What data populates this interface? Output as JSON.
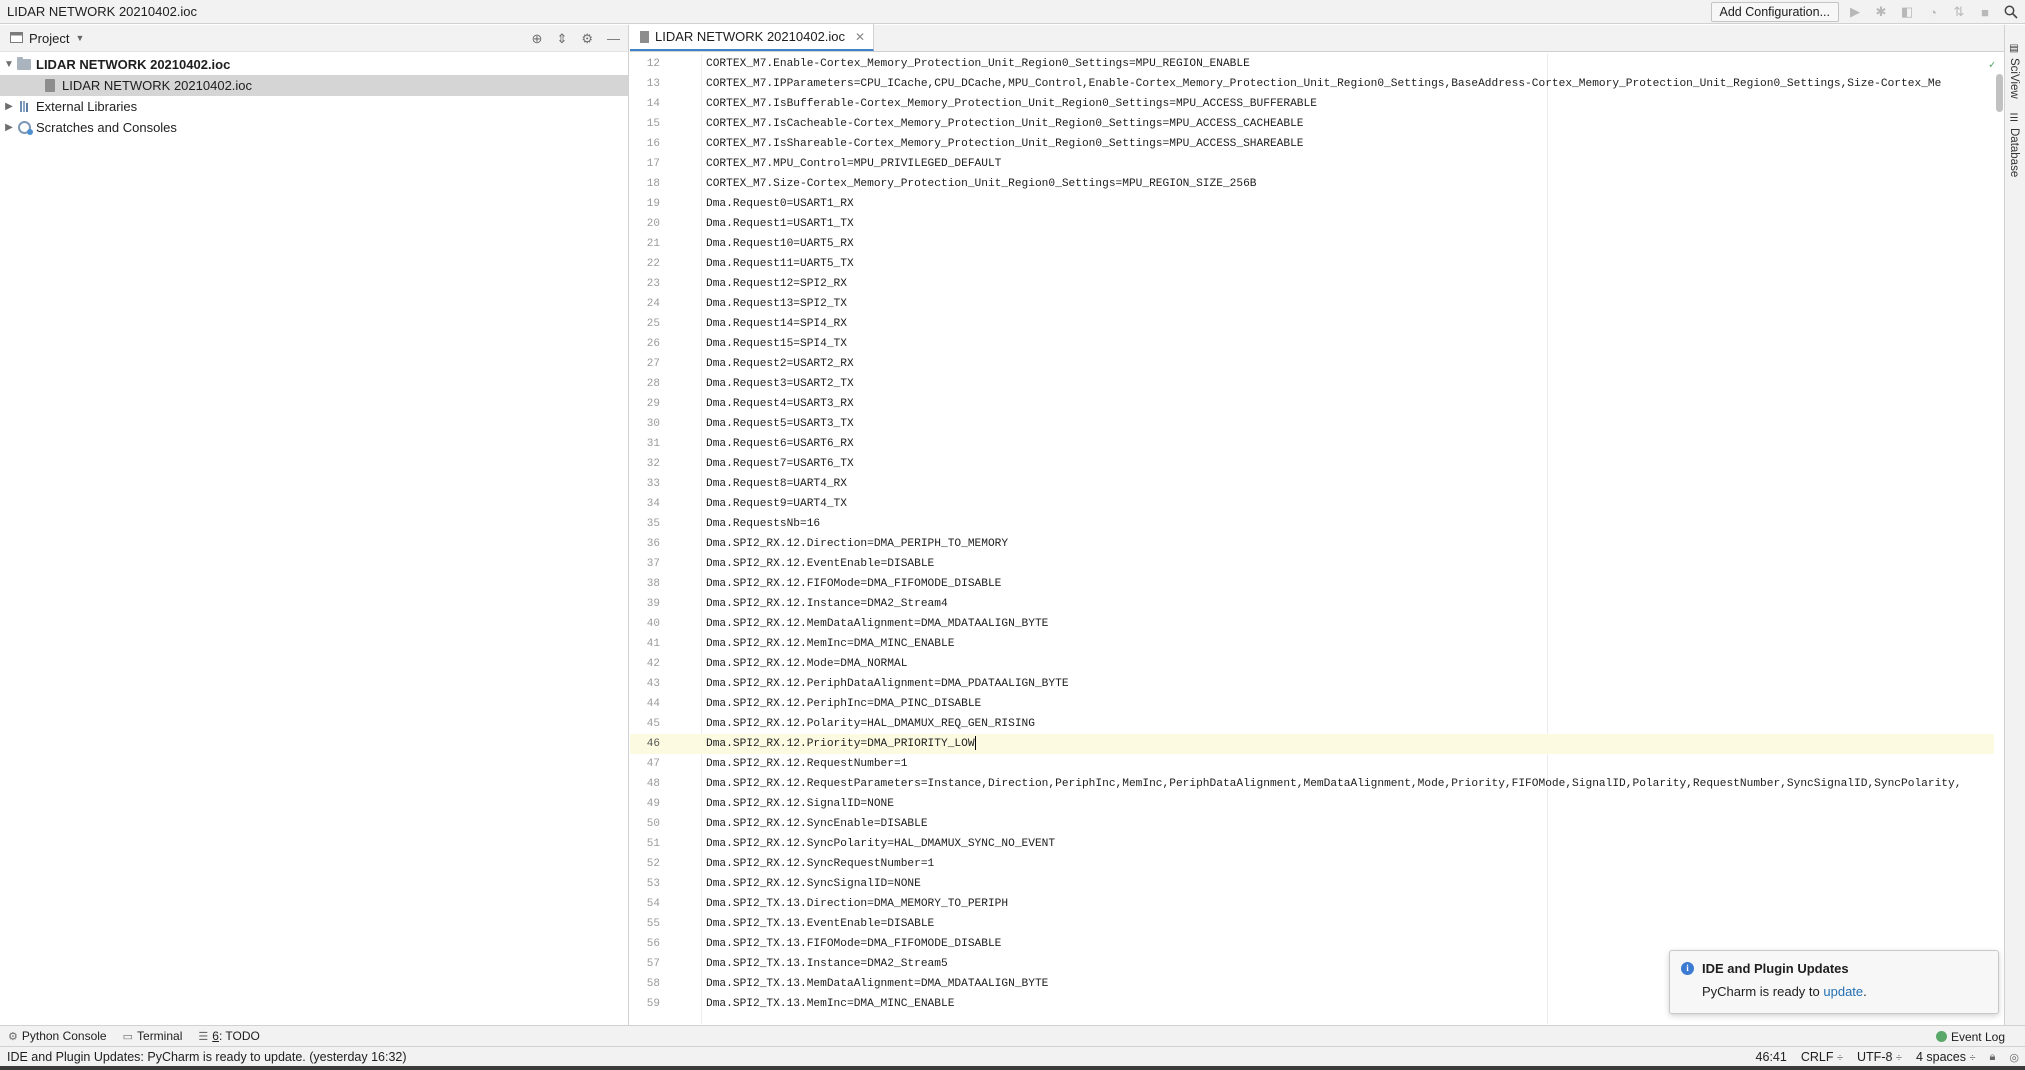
{
  "window": {
    "title": "LIDAR NETWORK 20210402.ioc"
  },
  "toolbar": {
    "add_configuration": "Add Configuration...",
    "icons": [
      "run-icon",
      "debug-icon",
      "coverage-icon",
      "profile-icon",
      "build-icon",
      "stop-icon",
      "search-icon"
    ]
  },
  "project_panel": {
    "title": "Project",
    "tree": [
      {
        "label": "LIDAR NETWORK 20210402.ioc",
        "level": 0,
        "type": "folder",
        "expanded": true,
        "bold": true
      },
      {
        "label": "LIDAR NETWORK 20210402.ioc",
        "level": 1,
        "type": "file",
        "selected": true
      },
      {
        "label": "External Libraries",
        "level": 0,
        "type": "libraries",
        "expanded": false
      },
      {
        "label": "Scratches and Consoles",
        "level": 0,
        "type": "scratches",
        "expanded": false
      }
    ]
  },
  "editor": {
    "tab_label": "LIDAR NETWORK 20210402.ioc",
    "current_line": 46,
    "lines": [
      {
        "n": 12,
        "t": "CORTEX_M7.Enable-Cortex_Memory_Protection_Unit_Region0_Settings=MPU_REGION_ENABLE"
      },
      {
        "n": 13,
        "t": "CORTEX_M7.IPParameters=CPU_ICache,CPU_DCache,MPU_Control,Enable-Cortex_Memory_Protection_Unit_Region0_Settings,BaseAddress-Cortex_Memory_Protection_Unit_Region0_Settings,Size-Cortex_Me"
      },
      {
        "n": 14,
        "t": "CORTEX_M7.IsBufferable-Cortex_Memory_Protection_Unit_Region0_Settings=MPU_ACCESS_BUFFERABLE"
      },
      {
        "n": 15,
        "t": "CORTEX_M7.IsCacheable-Cortex_Memory_Protection_Unit_Region0_Settings=MPU_ACCESS_CACHEABLE"
      },
      {
        "n": 16,
        "t": "CORTEX_M7.IsShareable-Cortex_Memory_Protection_Unit_Region0_Settings=MPU_ACCESS_SHAREABLE"
      },
      {
        "n": 17,
        "t": "CORTEX_M7.MPU_Control=MPU_PRIVILEGED_DEFAULT"
      },
      {
        "n": 18,
        "t": "CORTEX_M7.Size-Cortex_Memory_Protection_Unit_Region0_Settings=MPU_REGION_SIZE_256B"
      },
      {
        "n": 19,
        "t": "Dma.Request0=USART1_RX"
      },
      {
        "n": 20,
        "t": "Dma.Request1=USART1_TX"
      },
      {
        "n": 21,
        "t": "Dma.Request10=UART5_RX"
      },
      {
        "n": 22,
        "t": "Dma.Request11=UART5_TX"
      },
      {
        "n": 23,
        "t": "Dma.Request12=SPI2_RX"
      },
      {
        "n": 24,
        "t": "Dma.Request13=SPI2_TX"
      },
      {
        "n": 25,
        "t": "Dma.Request14=SPI4_RX"
      },
      {
        "n": 26,
        "t": "Dma.Request15=SPI4_TX"
      },
      {
        "n": 27,
        "t": "Dma.Request2=USART2_RX"
      },
      {
        "n": 28,
        "t": "Dma.Request3=USART2_TX"
      },
      {
        "n": 29,
        "t": "Dma.Request4=USART3_RX"
      },
      {
        "n": 30,
        "t": "Dma.Request5=USART3_TX"
      },
      {
        "n": 31,
        "t": "Dma.Request6=USART6_RX"
      },
      {
        "n": 32,
        "t": "Dma.Request7=USART6_TX"
      },
      {
        "n": 33,
        "t": "Dma.Request8=UART4_RX"
      },
      {
        "n": 34,
        "t": "Dma.Request9=UART4_TX"
      },
      {
        "n": 35,
        "t": "Dma.RequestsNb=16"
      },
      {
        "n": 36,
        "t": "Dma.SPI2_RX.12.Direction=DMA_PERIPH_TO_MEMORY"
      },
      {
        "n": 37,
        "t": "Dma.SPI2_RX.12.EventEnable=DISABLE"
      },
      {
        "n": 38,
        "t": "Dma.SPI2_RX.12.FIFOMode=DMA_FIFOMODE_DISABLE"
      },
      {
        "n": 39,
        "t": "Dma.SPI2_RX.12.Instance=DMA2_Stream4"
      },
      {
        "n": 40,
        "t": "Dma.SPI2_RX.12.MemDataAlignment=DMA_MDATAALIGN_BYTE"
      },
      {
        "n": 41,
        "t": "Dma.SPI2_RX.12.MemInc=DMA_MINC_ENABLE"
      },
      {
        "n": 42,
        "t": "Dma.SPI2_RX.12.Mode=DMA_NORMAL"
      },
      {
        "n": 43,
        "t": "Dma.SPI2_RX.12.PeriphDataAlignment=DMA_PDATAALIGN_BYTE"
      },
      {
        "n": 44,
        "t": "Dma.SPI2_RX.12.PeriphInc=DMA_PINC_DISABLE"
      },
      {
        "n": 45,
        "t": "Dma.SPI2_RX.12.Polarity=HAL_DMAMUX_REQ_GEN_RISING"
      },
      {
        "n": 46,
        "t": "Dma.SPI2_RX.12.Priority=DMA_PRIORITY_LOW"
      },
      {
        "n": 47,
        "t": "Dma.SPI2_RX.12.RequestNumber=1"
      },
      {
        "n": 48,
        "t": "Dma.SPI2_RX.12.RequestParameters=Instance,Direction,PeriphInc,MemInc,PeriphDataAlignment,MemDataAlignment,Mode,Priority,FIFOMode,SignalID,Polarity,RequestNumber,SyncSignalID,SyncPolarity,"
      },
      {
        "n": 49,
        "t": "Dma.SPI2_RX.12.SignalID=NONE"
      },
      {
        "n": 50,
        "t": "Dma.SPI2_RX.12.SyncEnable=DISABLE"
      },
      {
        "n": 51,
        "t": "Dma.SPI2_RX.12.SyncPolarity=HAL_DMAMUX_SYNC_NO_EVENT"
      },
      {
        "n": 52,
        "t": "Dma.SPI2_RX.12.SyncRequestNumber=1"
      },
      {
        "n": 53,
        "t": "Dma.SPI2_RX.12.SyncSignalID=NONE"
      },
      {
        "n": 54,
        "t": "Dma.SPI2_TX.13.Direction=DMA_MEMORY_TO_PERIPH"
      },
      {
        "n": 55,
        "t": "Dma.SPI2_TX.13.EventEnable=DISABLE"
      },
      {
        "n": 56,
        "t": "Dma.SPI2_TX.13.FIFOMode=DMA_FIFOMODE_DISABLE"
      },
      {
        "n": 57,
        "t": "Dma.SPI2_TX.13.Instance=DMA2_Stream5"
      },
      {
        "n": 58,
        "t": "Dma.SPI2_TX.13.MemDataAlignment=DMA_MDATAALIGN_BYTE"
      },
      {
        "n": 59,
        "t": "Dma.SPI2_TX.13.MemInc=DMA_MINC_ENABLE"
      }
    ]
  },
  "right_stripe": {
    "sciview": "SciView",
    "database": "Database"
  },
  "notification": {
    "title": "IDE and Plugin Updates",
    "body_prefix": "PyCharm is ready to ",
    "link": "update",
    "body_suffix": "."
  },
  "tool_windows": {
    "python_console": "Python Console",
    "terminal": "Terminal",
    "todo_number": "6",
    "todo_label": ": TODO",
    "event_log": "Event Log"
  },
  "status": {
    "message": "IDE and Plugin Updates: PyCharm is ready to update. (yesterday 16:32)",
    "position": "46:41",
    "line_separator": "CRLF",
    "encoding": "UTF-8",
    "indent": "4 spaces"
  },
  "colors": {
    "accent": "#4083c9",
    "current_line": "#fcfae1",
    "selection": "#d5d5d5",
    "link": "#2470b3",
    "ok_green": "#59a869"
  }
}
